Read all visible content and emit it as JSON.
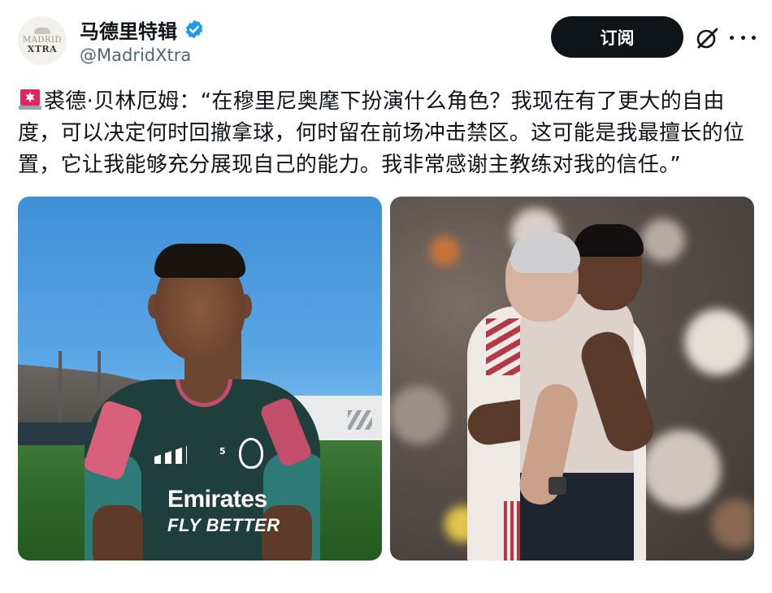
{
  "account": {
    "display_name": "马德里特辑",
    "handle": "@MadridXtra",
    "avatar_line1": "MADRID",
    "avatar_line2": "XTRA"
  },
  "actions": {
    "subscribe_label": "订阅"
  },
  "tweet": {
    "text": "裘德·贝林厄姆：“在穆里尼奥麾下扮演什么角色？我现在有了更大的自由度，可以决定何时回撤拿球，何时留在前场冲击禁区。这可能是我最擅长的位置，它让我能够充分展现自己的能力。我非常感谢主教练对我的信任。”"
  },
  "media": {
    "photo1": {
      "sponsor_line1": "Emirates",
      "sponsor_line2": "FLY BETTER",
      "shirt_number": "5"
    }
  },
  "colors": {
    "subscribe_bg": "#0f1419",
    "verified": "#1d9bf0",
    "siren": "#e0245e"
  },
  "icons": {
    "verified": "verified-badge-icon",
    "grok": "grok-icon",
    "more": "more-icon",
    "siren": "siren-emoji-icon"
  }
}
